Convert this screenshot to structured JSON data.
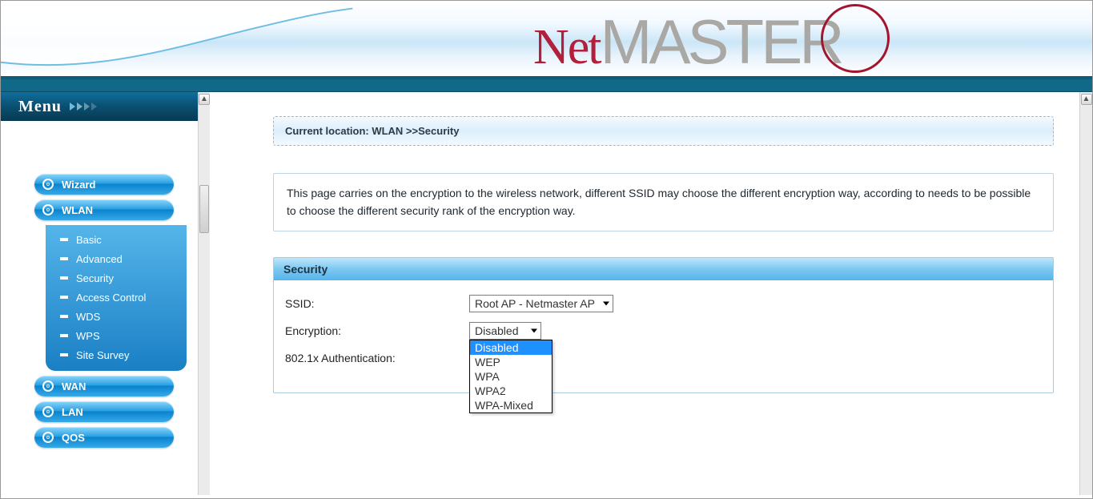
{
  "brand": {
    "net": "Net",
    "master": "MASTER"
  },
  "menu_header": "Menu",
  "nav": {
    "wizard": "Wizard",
    "wlan": {
      "label": "WLAN",
      "items": [
        "Basic",
        "Advanced",
        "Security",
        "Access Control",
        "WDS",
        "WPS",
        "Site Survey"
      ]
    },
    "wan": "WAN",
    "lan": "LAN",
    "qos": "QOS"
  },
  "breadcrumb": "Current location: WLAN >>Security",
  "description": "This page carries on the encryption to the wireless network, different SSID may choose the different encryption way, according to needs to be possible to choose the different security rank of the encryption way.",
  "panel": {
    "title": "Security",
    "ssid_label": "SSID:",
    "ssid_value": "Root AP - Netmaster AP",
    "encryption_label": "Encryption:",
    "encryption_value": "Disabled",
    "encryption_options": [
      "Disabled",
      "WEP",
      "WPA",
      "WPA2",
      "WPA-Mixed"
    ],
    "auth_label": "802.1x Authentication:"
  }
}
